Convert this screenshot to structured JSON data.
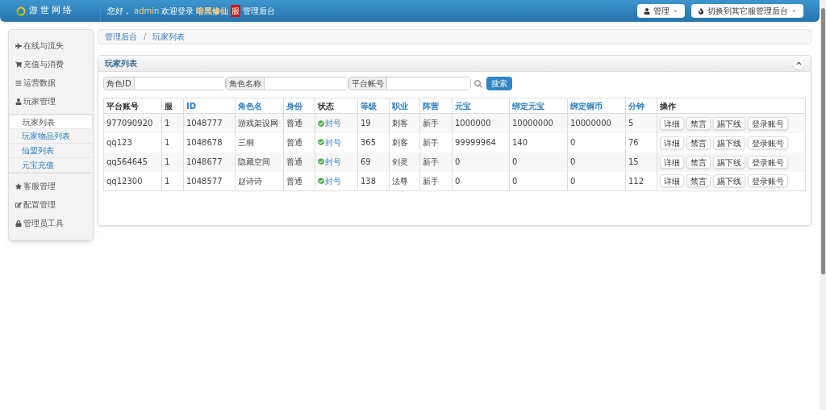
{
  "header": {
    "logo_text": "游世网络",
    "greeting": [
      {
        "text": "您好，",
        "kind": "plain"
      },
      {
        "text": "admin",
        "kind": "user"
      },
      {
        "text": "欢迎登录",
        "kind": "plain"
      },
      {
        "text": "暗黑修仙",
        "kind": "game"
      },
      {
        "text": "服",
        "kind": "server"
      },
      {
        "text": "管理后台",
        "kind": "plain"
      }
    ],
    "buttons": [
      {
        "label": "管理"
      },
      {
        "label": "切换到其它服管理后台"
      }
    ]
  },
  "sidebar": {
    "items": [
      {
        "label": "在线与流失"
      },
      {
        "label": "充值与消费"
      },
      {
        "label": "运营数据"
      },
      {
        "label": "玩家管理",
        "children": [
          {
            "label": "玩家列表",
            "selected": true
          },
          {
            "label": "玩家物品列表",
            "selected": false
          },
          {
            "label": "仙盟列表",
            "selected": false
          },
          {
            "label": "元宝充值",
            "selected": false
          }
        ]
      },
      {
        "label": "客服管理"
      },
      {
        "label": "配置管理"
      },
      {
        "label": "管理员工具"
      }
    ]
  },
  "breadcrumb": {
    "items": [
      "管理后台",
      "玩家列表"
    ],
    "separator": "/"
  },
  "panel": {
    "title": "玩家列表",
    "filters": [
      {
        "label": "角色ID"
      },
      {
        "label": "角色名称"
      },
      {
        "label": "平台帐号"
      }
    ],
    "search_button": "搜索",
    "table": {
      "columns": [
        {
          "label": "平台账号",
          "sortable": false
        },
        {
          "label": "服",
          "sortable": false
        },
        {
          "label": "ID",
          "sortable": true
        },
        {
          "label": "角色名",
          "sortable": true
        },
        {
          "label": "身份",
          "sortable": true
        },
        {
          "label": "状态",
          "sortable": false
        },
        {
          "label": "等级",
          "sortable": true
        },
        {
          "label": "职业",
          "sortable": true
        },
        {
          "label": "阵营",
          "sortable": true
        },
        {
          "label": "元宝",
          "sortable": true
        },
        {
          "label": "绑定元宝",
          "sortable": true
        },
        {
          "label": "绑定铜币",
          "sortable": true
        },
        {
          "label": "分钟",
          "sortable": true
        },
        {
          "label": "操作",
          "sortable": false
        }
      ],
      "rows": [
        {
          "cells": [
            "977090920",
            "1",
            "1048777",
            "游戏架设网",
            "普通",
            "封号",
            "19",
            "刺客",
            "新手",
            "1000000",
            "10000000",
            "10000000",
            "5"
          ],
          "actions": [
            "详细",
            "禁言",
            "踢下线",
            "登录账号"
          ]
        },
        {
          "cells": [
            "qq123",
            "1",
            "1048678",
            "三桐",
            "普通",
            "封号",
            "365",
            "刺客",
            "新手",
            "99999964",
            "140",
            "0",
            "76"
          ],
          "actions": [
            "详细",
            "禁言",
            "踢下线",
            "登录账号"
          ]
        },
        {
          "cells": [
            "qq564645",
            "1",
            "1048677",
            "隐藏空间",
            "普通",
            "封号",
            "69",
            "剑灵",
            "新手",
            "0",
            "0",
            "0",
            "15"
          ],
          "actions": [
            "详细",
            "禁言",
            "踢下线",
            "登录账号"
          ]
        },
        {
          "cells": [
            "qq12300",
            "1",
            "1048577",
            "赵诗诗",
            "普通",
            "封号",
            "138",
            "法尊",
            "新手",
            "0",
            "0",
            "0",
            "112"
          ],
          "actions": [
            "详细",
            "禁言",
            "踢下线",
            "登录账号"
          ]
        }
      ]
    }
  }
}
